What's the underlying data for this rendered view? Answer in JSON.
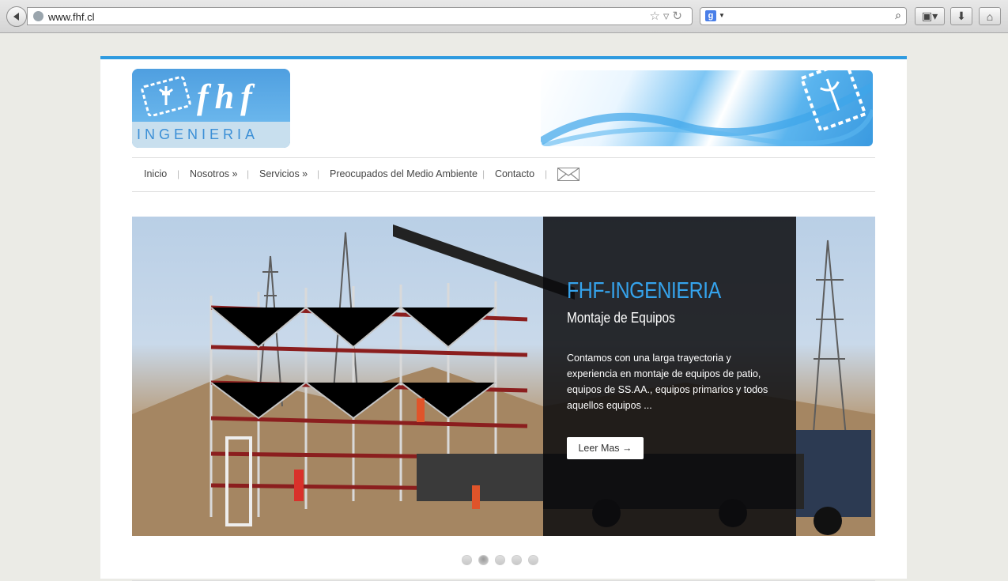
{
  "browser": {
    "url": "www.fhf.cl"
  },
  "logo": {
    "main": "fhf",
    "sub": "INGENIERIA"
  },
  "nav": {
    "items": [
      {
        "label": "Inicio"
      },
      {
        "label": "Nosotros »"
      },
      {
        "label": "Servicios »"
      },
      {
        "label": "Preocupados del Medio Ambiente"
      },
      {
        "label": "Contacto"
      }
    ],
    "separator": "|"
  },
  "slide": {
    "title": "FHF-INGENIERIA",
    "subtitle": "Montaje de Equipos",
    "text": "Contamos con una larga trayectoria y experiencia en montaje de equipos de patio, equipos de SS.AA., equipos primarios y todos aquellos equipos ...",
    "button": "Leer Mas →"
  },
  "pagination": {
    "count": 5,
    "active_index": 1
  },
  "colors": {
    "accent": "#2f9be0",
    "caption_title": "#35a3ec"
  }
}
